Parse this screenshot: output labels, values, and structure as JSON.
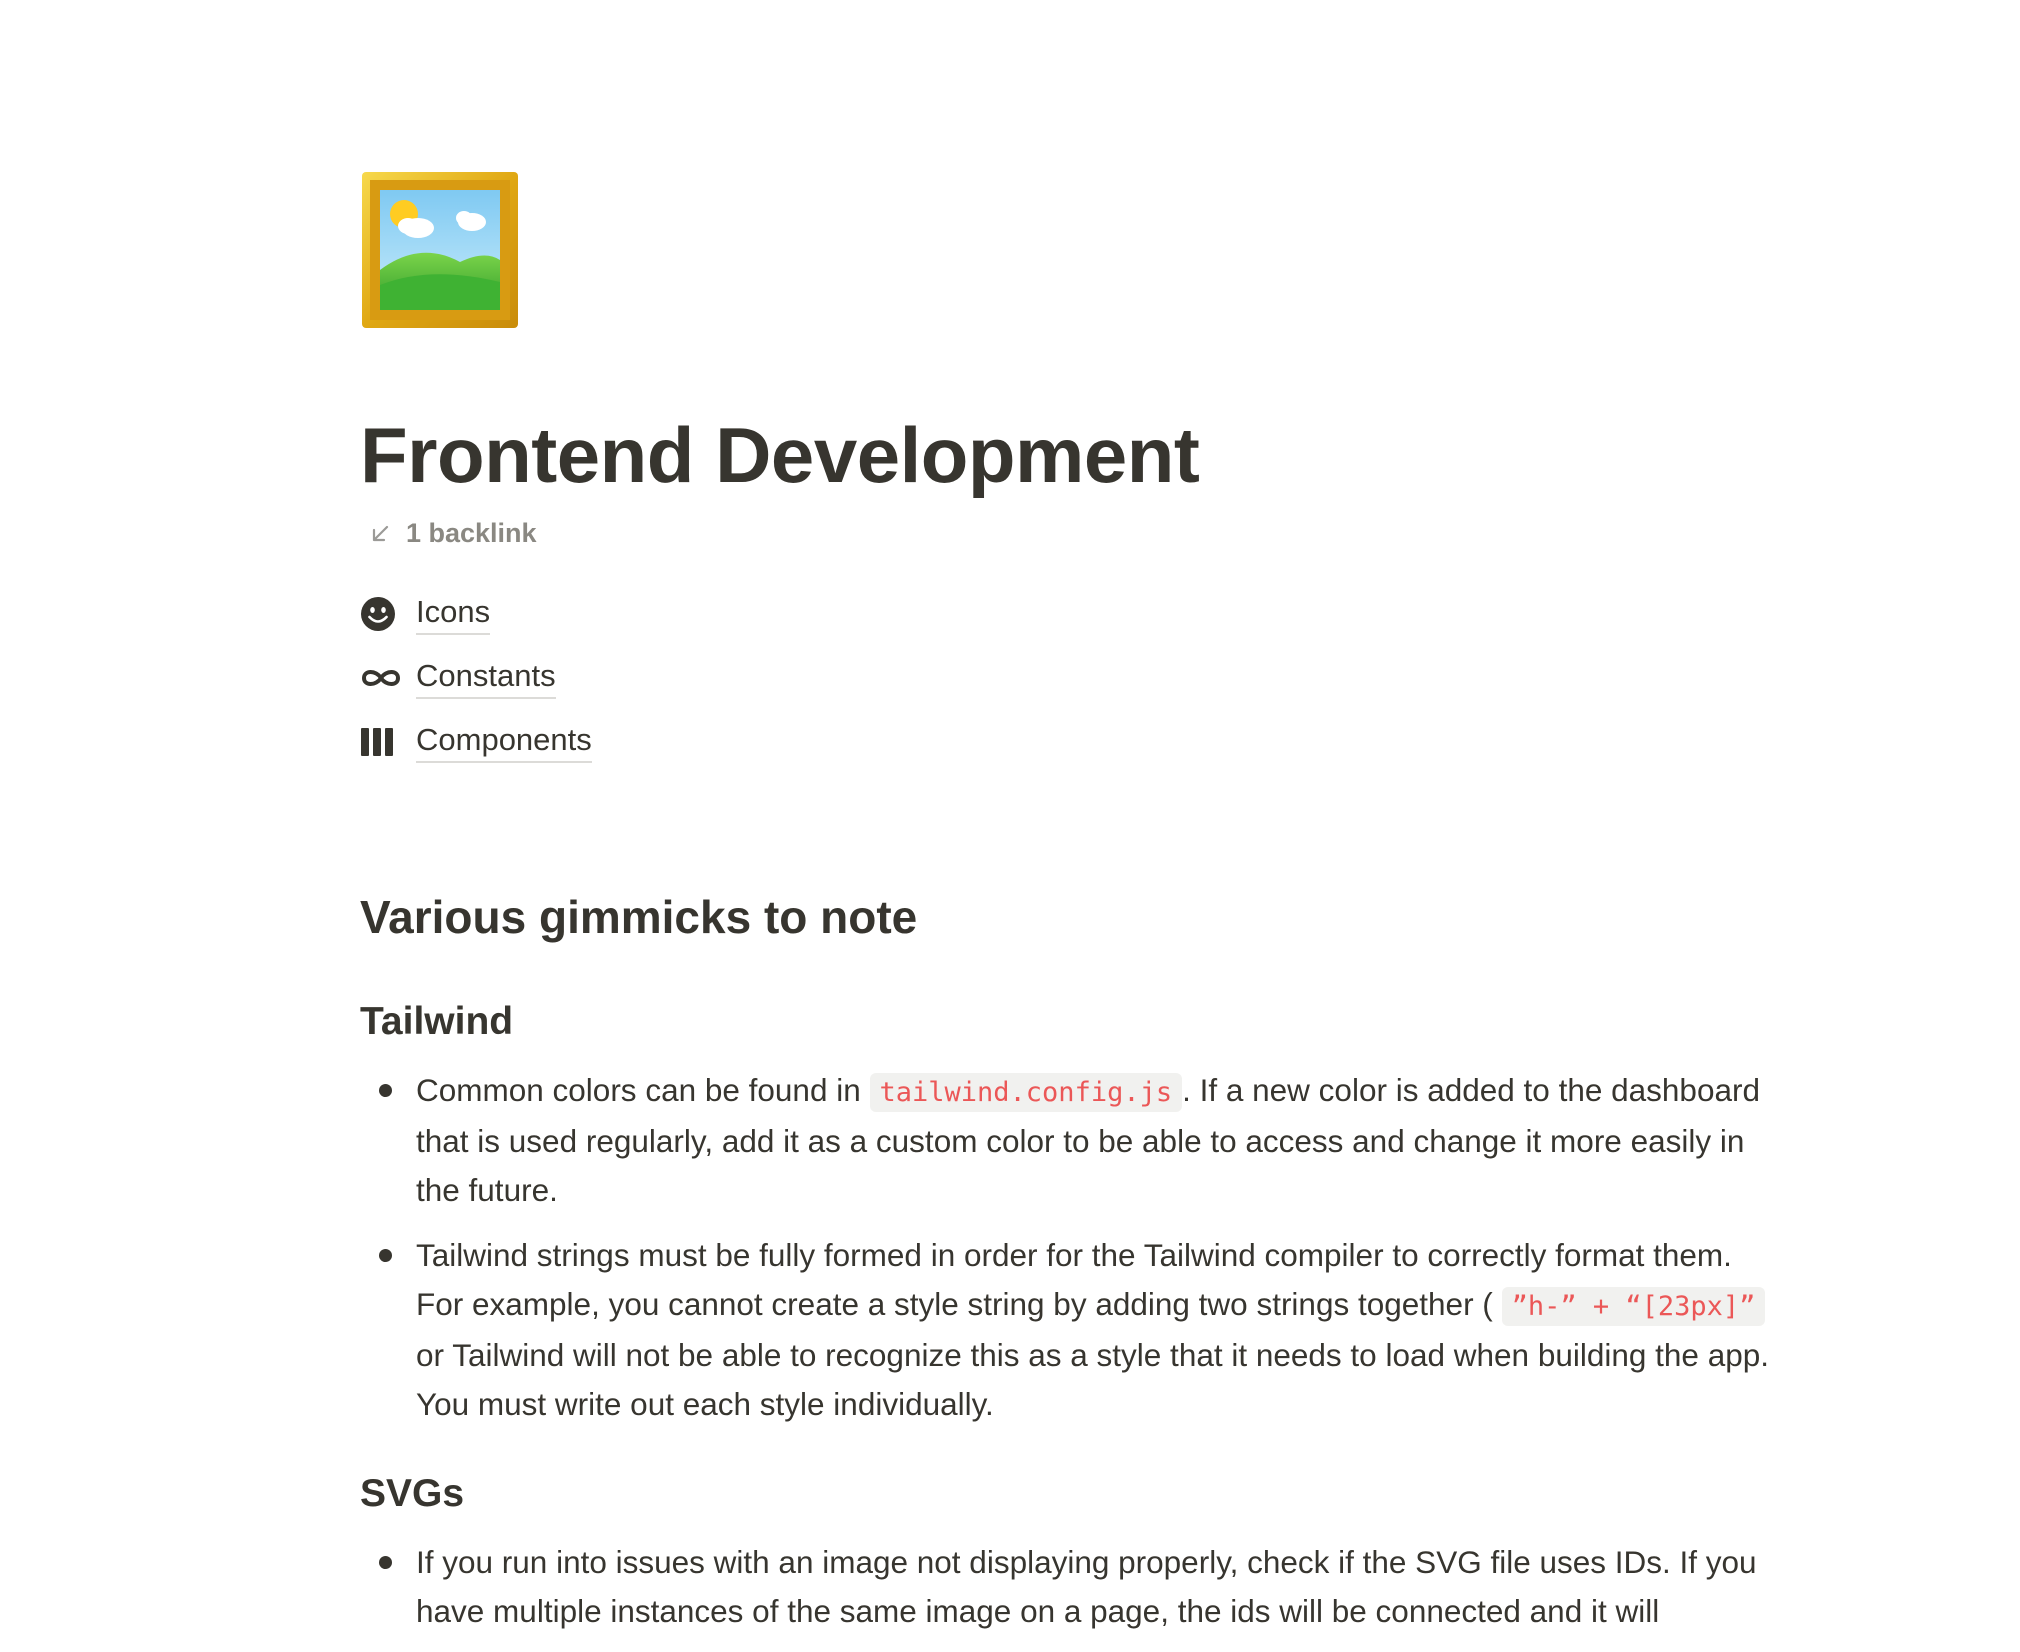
{
  "page": {
    "icon": "framed-picture-icon",
    "title": "Frontend Development",
    "backlinks_label": "1 backlink"
  },
  "subpages": [
    {
      "icon": "smiley-face-icon",
      "label": "Icons"
    },
    {
      "icon": "infinity-icon",
      "label": "Constants"
    },
    {
      "icon": "columns-icon",
      "label": "Components"
    }
  ],
  "section": {
    "heading": "Various gimmicks to note"
  },
  "tailwind": {
    "heading": "Tailwind",
    "bullet1": {
      "text_before": "Common colors can be found in ",
      "code": "tailwind.config.js",
      "text_after": ". If a new color is added to the dashboard that is used regularly, add it as a custom color to be able to access and change it more easily in the future."
    },
    "bullet2": {
      "text_before": "Tailwind strings must be fully formed in order for the Tailwind compiler to correctly format them. For example, you cannot create a style string by adding two strings together ( ",
      "code": "”h-” + “[23px]”",
      "text_after": " or Tailwind will not be able to recognize this as a style that it needs to load when building the app. You must write out each style individually."
    }
  },
  "svgs": {
    "heading": "SVGs",
    "bullet1": "If you run into issues with an image not displaying properly, check if the SVG file uses IDs. If you have multiple instances of the same image on a page, the ids will be connected and it will"
  },
  "colors": {
    "text": "#37352f",
    "muted": "#8a8882",
    "code_text": "#eb5757",
    "code_bg": "#f1f1ef",
    "link_underline": "#dcdbd8"
  }
}
